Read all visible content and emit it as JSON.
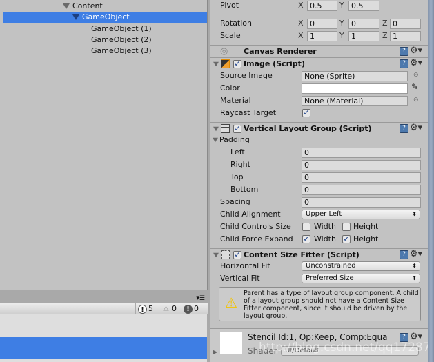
{
  "hierarchy": {
    "items": [
      "Content",
      "GameObject",
      "GameObject (1)",
      "GameObject (2)",
      "GameObject (3)"
    ]
  },
  "console": {
    "info_count": "5",
    "warning_count": "0",
    "error_count": "0"
  },
  "transform": {
    "pivot_label": "Pivot",
    "pivot": {
      "x": "0.5",
      "y": "0.5"
    },
    "rotation_label": "Rotation",
    "rotation": {
      "x": "0",
      "y": "0",
      "z": "0"
    },
    "scale_label": "Scale",
    "scale": {
      "x": "1",
      "y": "1",
      "z": "1"
    },
    "axes": {
      "x": "X",
      "y": "Y",
      "z": "Z"
    }
  },
  "canvas_renderer": {
    "title": "Canvas Renderer"
  },
  "image": {
    "title": "Image (Script)",
    "source_image_label": "Source Image",
    "source_image": "None (Sprite)",
    "color_label": "Color",
    "color_value": "#ffffff",
    "material_label": "Material",
    "material": "None (Material)",
    "raycast_label": "Raycast Target",
    "raycast": true
  },
  "vlg": {
    "title": "Vertical Layout Group (Script)",
    "padding_label": "Padding",
    "left_label": "Left",
    "left": "0",
    "right_label": "Right",
    "right": "0",
    "top_label": "Top",
    "top": "0",
    "bottom_label": "Bottom",
    "bottom": "0",
    "spacing_label": "Spacing",
    "spacing": "0",
    "alignment_label": "Child Alignment",
    "alignment": "Upper Left",
    "controls_label": "Child Controls Size",
    "expand_label": "Child Force Expand",
    "width_label": "Width",
    "height_label": "Height",
    "controls_width": false,
    "controls_height": false,
    "expand_width": true,
    "expand_height": true
  },
  "csf": {
    "title": "Content Size Fitter (Script)",
    "hfit_label": "Horizontal Fit",
    "hfit": "Unconstrained",
    "vfit_label": "Vertical Fit",
    "vfit": "Preferred Size",
    "warning": "Parent has a type of layout group component. A child of a layout group should not have a Content Size Fitter component, since it should be driven by the layout group."
  },
  "material_preview": {
    "title": "Stencil Id:1, Op:Keep, Comp:Equa",
    "shader_label": "Shader",
    "shader": "UI/Default"
  },
  "watermark": "http://blog.csdn.net/qq17287",
  "colors": {
    "selection": "#3e7ee4",
    "panel": "#c2c2c2"
  }
}
